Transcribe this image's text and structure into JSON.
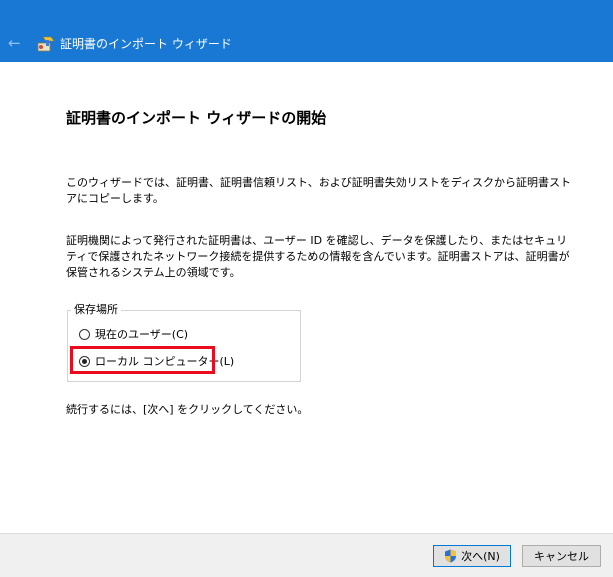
{
  "window": {
    "title": "証明書のインポート ウィザード"
  },
  "main": {
    "heading": "証明書のインポート ウィザードの開始",
    "intro": "このウィザードでは、証明書、証明書信頼リスト、および証明書失効リストをディスクから証明書ストアにコピーします。",
    "description": "証明機関によって発行された証明書は、ユーザー ID を確認し、データを保護したり、またはセキュリティで保護されたネットワーク接続を提供するための情報を含んでいます。証明書ストアは、証明書が保管されるシステム上の領域です。",
    "store_location": {
      "label": "保存場所",
      "options": [
        {
          "label": "現在のユーザー(C)",
          "selected": false
        },
        {
          "label": "ローカル コンピューター(L)",
          "selected": true
        }
      ]
    },
    "continue_text": "続行するには、[次へ] をクリックしてください。"
  },
  "footer": {
    "next_label": "次へ(N)",
    "cancel_label": "キャンセル"
  },
  "colors": {
    "titlebar": "#1978d4",
    "highlight": "#ea0b1e"
  }
}
